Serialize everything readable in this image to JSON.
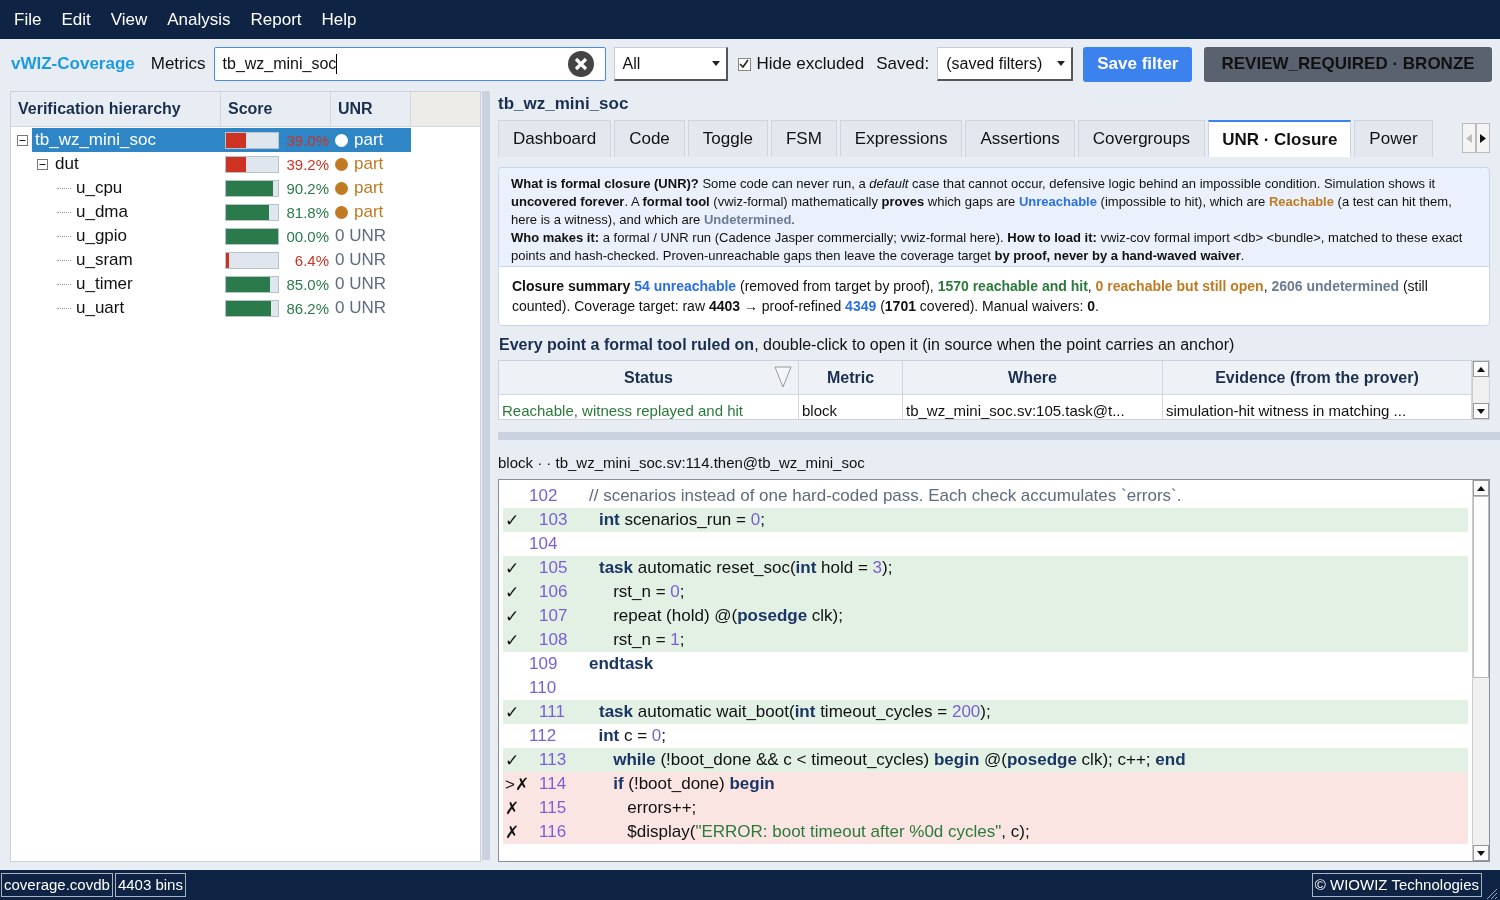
{
  "menu": [
    "File",
    "Edit",
    "View",
    "Analysis",
    "Report",
    "Help"
  ],
  "toolbar": {
    "app_name": "vWIZ-Coverage",
    "metrics_label": "Metrics",
    "search_value": "tb_wz_mini_soc",
    "filter": "All",
    "hide_excluded": {
      "label": "Hide excluded",
      "checked": true
    },
    "saved_label": "Saved:",
    "saved_value": "(saved filters)",
    "save_button": "Save filter",
    "status_badge": "REVIEW_REQUIRED · BRONZE"
  },
  "hierarchy": {
    "columns": [
      "Verification hierarchy",
      "Score",
      "UNR"
    ],
    "items": [
      {
        "name": "tb_wz_mini_soc",
        "selected": true,
        "expanded": true,
        "score": {
          "text": "39.0%",
          "kind": "low",
          "level": 0.39
        },
        "unr": {
          "text": "part",
          "kind": "partial"
        },
        "children": [
          {
            "name": "dut",
            "selected": false,
            "expanded": true,
            "score": {
              "text": "39.2%",
              "kind": "low",
              "level": 0.392
            },
            "unr": {
              "text": "part",
              "kind": "partial"
            },
            "children": [
              {
                "name": "u_cpu",
                "selected": false,
                "score": {
                  "text": "90.2%",
                  "kind": "high",
                  "level": 0.902
                },
                "unr": {
                  "text": "part",
                  "kind": "partial"
                }
              },
              {
                "name": "u_dma",
                "selected": false,
                "score": {
                  "text": "81.8%",
                  "kind": "high",
                  "level": 0.818
                },
                "unr": {
                  "text": "part",
                  "kind": "partial"
                }
              },
              {
                "name": "u_gpio",
                "selected": false,
                "score": {
                  "text": "00.0%",
                  "kind": "high",
                  "level": 1.0
                },
                "unr": {
                  "text": "0 UNR",
                  "kind": "count"
                }
              },
              {
                "name": "u_sram",
                "selected": false,
                "score": {
                  "text": "6.4%",
                  "kind": "low",
                  "level": 0.064
                },
                "unr": {
                  "text": "0 UNR",
                  "kind": "count"
                }
              },
              {
                "name": "u_timer",
                "selected": false,
                "score": {
                  "text": "85.0%",
                  "kind": "high",
                  "level": 0.85
                },
                "unr": {
                  "text": "0 UNR",
                  "kind": "count"
                }
              },
              {
                "name": "u_uart",
                "selected": false,
                "score": {
                  "text": "86.2%",
                  "kind": "high",
                  "level": 0.862
                },
                "unr": {
                  "text": "0 UNR",
                  "kind": "count"
                }
              }
            ]
          }
        ]
      }
    ]
  },
  "detail": {
    "title": "tb_wz_mini_soc",
    "tabs": [
      {
        "label": "Dashboard",
        "selected": false
      },
      {
        "label": "Code",
        "selected": false
      },
      {
        "label": "Toggle",
        "selected": false
      },
      {
        "label": "FSM",
        "selected": false
      },
      {
        "label": "Expressions",
        "selected": false
      },
      {
        "label": "Assertions",
        "selected": false
      },
      {
        "label": "Covergroups",
        "selected": false
      },
      {
        "label": "UNR · Closure",
        "selected": true
      },
      {
        "label": "Power",
        "selected": false
      }
    ],
    "info": [
      [
        {
          "kind": "term",
          "text": "What is formal closure (UNR)?"
        },
        {
          "kind": "plain",
          "text": "  Some code can never run, a "
        },
        {
          "kind": "emphasis",
          "text": "default"
        },
        {
          "kind": "plain",
          "text": " case that cannot occur, defensive logic behind an impossible condition. Simulation shows it "
        },
        {
          "kind": "term",
          "text": "uncovered forever"
        },
        {
          "kind": "plain",
          "text": ". A "
        },
        {
          "kind": "term",
          "text": "formal tool"
        },
        {
          "kind": "plain",
          "text": " (vwiz-formal) mathematically "
        },
        {
          "kind": "term",
          "text": "proves"
        },
        {
          "kind": "plain",
          "text": " which gaps are "
        },
        {
          "kind": "unreachable",
          "text": "Unreachable"
        },
        {
          "kind": "plain",
          "text": " (impossible to hit), which are "
        },
        {
          "kind": "reachable",
          "text": "Reachable"
        },
        {
          "kind": "plain",
          "text": " (a test can hit them, here is a witness), and which are "
        },
        {
          "kind": "undetermined",
          "text": "Undetermined"
        },
        {
          "kind": "plain",
          "text": "."
        }
      ],
      [
        {
          "kind": "term",
          "text": "Who makes it:"
        },
        {
          "kind": "plain",
          "text": " a formal / UNR run (Cadence Jasper commercially; vwiz-formal here).  "
        },
        {
          "kind": "term",
          "text": "How to load it:"
        },
        {
          "kind": "plain",
          "text": " vwiz-cov formal import <db> <bundle>, matched to these exact points and hash-checked.  Proven-unreachable gaps then leave the coverage target "
        },
        {
          "kind": "term",
          "text": "by proof, never by a hand-waved waiver"
        },
        {
          "kind": "plain",
          "text": "."
        }
      ]
    ],
    "summary": [
      {
        "kind": "term",
        "text": "Closure summary  "
      },
      {
        "kind": "unreachable",
        "text": "54 unreachable"
      },
      {
        "kind": "plain",
        "text": " (removed from target by proof), "
      },
      {
        "kind": "hit",
        "text": "1570 reachable and hit"
      },
      {
        "kind": "plain",
        "text": ", "
      },
      {
        "kind": "reachable",
        "text": "0 reachable but still open"
      },
      {
        "kind": "plain",
        "text": ", "
      },
      {
        "kind": "undetermined",
        "text": "2606 undetermined"
      },
      {
        "kind": "plain",
        "text": " (still counted).  Coverage target: raw "
      },
      {
        "kind": "term",
        "text": "4403"
      },
      {
        "kind": "plain",
        "text": " → proof-refined "
      },
      {
        "kind": "unreachable",
        "text": "4349"
      },
      {
        "kind": "plain",
        "text": "  ("
      },
      {
        "kind": "term",
        "text": "1701"
      },
      {
        "kind": "plain",
        "text": " covered). Manual waivers: "
      },
      {
        "kind": "term",
        "text": "0"
      },
      {
        "kind": "plain",
        "text": "."
      }
    ],
    "points_heading": [
      {
        "kind": "term",
        "text": "Every point a formal tool ruled on"
      },
      {
        "kind": "plain",
        "text": ", double-click to open it (in source when the point carries an anchor)"
      }
    ],
    "points": {
      "columns": [
        "Status",
        "Metric",
        "Where",
        "Evidence (from the prover)"
      ],
      "rows": [
        {
          "status": "Reachable, witness replayed and hit",
          "kind": "reachable",
          "metric": "block",
          "where": "tb_wz_mini_soc.sv:105.task@t...",
          "evidence": "simulation-hit witness in matching ..."
        }
      ]
    },
    "breadcrumb": "block ·  · tb_wz_mini_soc.sv:114.then@tb_wz_mini_soc",
    "code": [
      {
        "number": "102",
        "kind": "plain",
        "tokens": [
          {
            "kind": "comment",
            "text": "// scenarios instead of one hard-coded pass. Each check accumulates `errors`."
          }
        ]
      },
      {
        "mark": "✓",
        "number": "103",
        "kind": "covered",
        "tokens": [
          {
            "kind": "keyword",
            "text": "int"
          },
          {
            "kind": "plain",
            "text": " scenarios_run = "
          },
          {
            "kind": "number",
            "text": "0"
          },
          {
            "kind": "plain",
            "text": ";"
          }
        ]
      },
      {
        "number": "104",
        "kind": "plain"
      },
      {
        "mark": "✓",
        "number": "105",
        "kind": "covered",
        "tokens": [
          {
            "kind": "keyword",
            "text": "task"
          },
          {
            "kind": "plain",
            "text": " automatic reset_soc("
          },
          {
            "kind": "keyword",
            "text": "int"
          },
          {
            "kind": "plain",
            "text": " hold = "
          },
          {
            "kind": "number",
            "text": "3"
          },
          {
            "kind": "plain",
            "text": ");"
          }
        ]
      },
      {
        "mark": "✓",
        "number": "106",
        "kind": "covered",
        "tokens": [
          {
            "kind": "plain",
            "text": "   rst_n = "
          },
          {
            "kind": "number",
            "text": "0"
          },
          {
            "kind": "plain",
            "text": ";"
          }
        ]
      },
      {
        "mark": "✓",
        "number": "107",
        "kind": "covered",
        "tokens": [
          {
            "kind": "plain",
            "text": "   repeat (hold) @("
          },
          {
            "kind": "keyword",
            "text": "posedge"
          },
          {
            "kind": "plain",
            "text": " clk);"
          }
        ]
      },
      {
        "mark": "✓",
        "number": "108",
        "kind": "covered",
        "tokens": [
          {
            "kind": "plain",
            "text": "   rst_n = "
          },
          {
            "kind": "number",
            "text": "1"
          },
          {
            "kind": "plain",
            "text": ";"
          }
        ]
      },
      {
        "number": "109",
        "kind": "plain",
        "tokens": [
          {
            "kind": "keyword",
            "text": "endtask"
          }
        ]
      },
      {
        "number": "110",
        "kind": "plain"
      },
      {
        "mark": "✓",
        "number": "111",
        "kind": "covered",
        "tokens": [
          {
            "kind": "keyword",
            "text": "task"
          },
          {
            "kind": "plain",
            "text": " automatic wait_boot("
          },
          {
            "kind": "keyword",
            "text": "int"
          },
          {
            "kind": "plain",
            "text": " timeout_cycles = "
          },
          {
            "kind": "number",
            "text": "200"
          },
          {
            "kind": "plain",
            "text": ");"
          }
        ]
      },
      {
        "number": "112",
        "kind": "plain",
        "tokens": [
          {
            "kind": "keyword",
            "text": "  int"
          },
          {
            "kind": "plain",
            "text": " c = "
          },
          {
            "kind": "number",
            "text": "0"
          },
          {
            "kind": "plain",
            "text": ";"
          }
        ]
      },
      {
        "mark": "✓",
        "number": "113",
        "kind": "covered",
        "tokens": [
          {
            "kind": "keyword",
            "text": "   while"
          },
          {
            "kind": "plain",
            "text": " (!boot_done && c < timeout_cycles) "
          },
          {
            "kind": "keyword",
            "text": "begin"
          },
          {
            "kind": "plain",
            "text": " @("
          },
          {
            "kind": "keyword",
            "text": "posedge"
          },
          {
            "kind": "plain",
            "text": " clk); c++; "
          },
          {
            "kind": "keyword",
            "text": "end"
          }
        ]
      },
      {
        "mark": ">✗",
        "number": "114",
        "kind": "uncovered",
        "tokens": [
          {
            "kind": "keyword",
            "text": "   if"
          },
          {
            "kind": "plain",
            "text": " (!boot_done) "
          },
          {
            "kind": "keyword",
            "text": "begin"
          }
        ]
      },
      {
        "mark": "✗",
        "number": "115",
        "kind": "uncovered",
        "tokens": [
          {
            "kind": "plain",
            "text": "      errors++;"
          }
        ]
      },
      {
        "mark": "✗",
        "number": "116",
        "kind": "uncovered",
        "tokens": [
          {
            "kind": "plain",
            "text": "      $display("
          },
          {
            "kind": "string",
            "text": "\"ERROR: boot timeout after %0d cycles\""
          },
          {
            "kind": "plain",
            "text": ", c);"
          }
        ]
      }
    ]
  },
  "status_bar": [
    "coverage.covdb",
    "4403 bins"
  ],
  "copyright": "© WIOWIZ Technologies"
}
